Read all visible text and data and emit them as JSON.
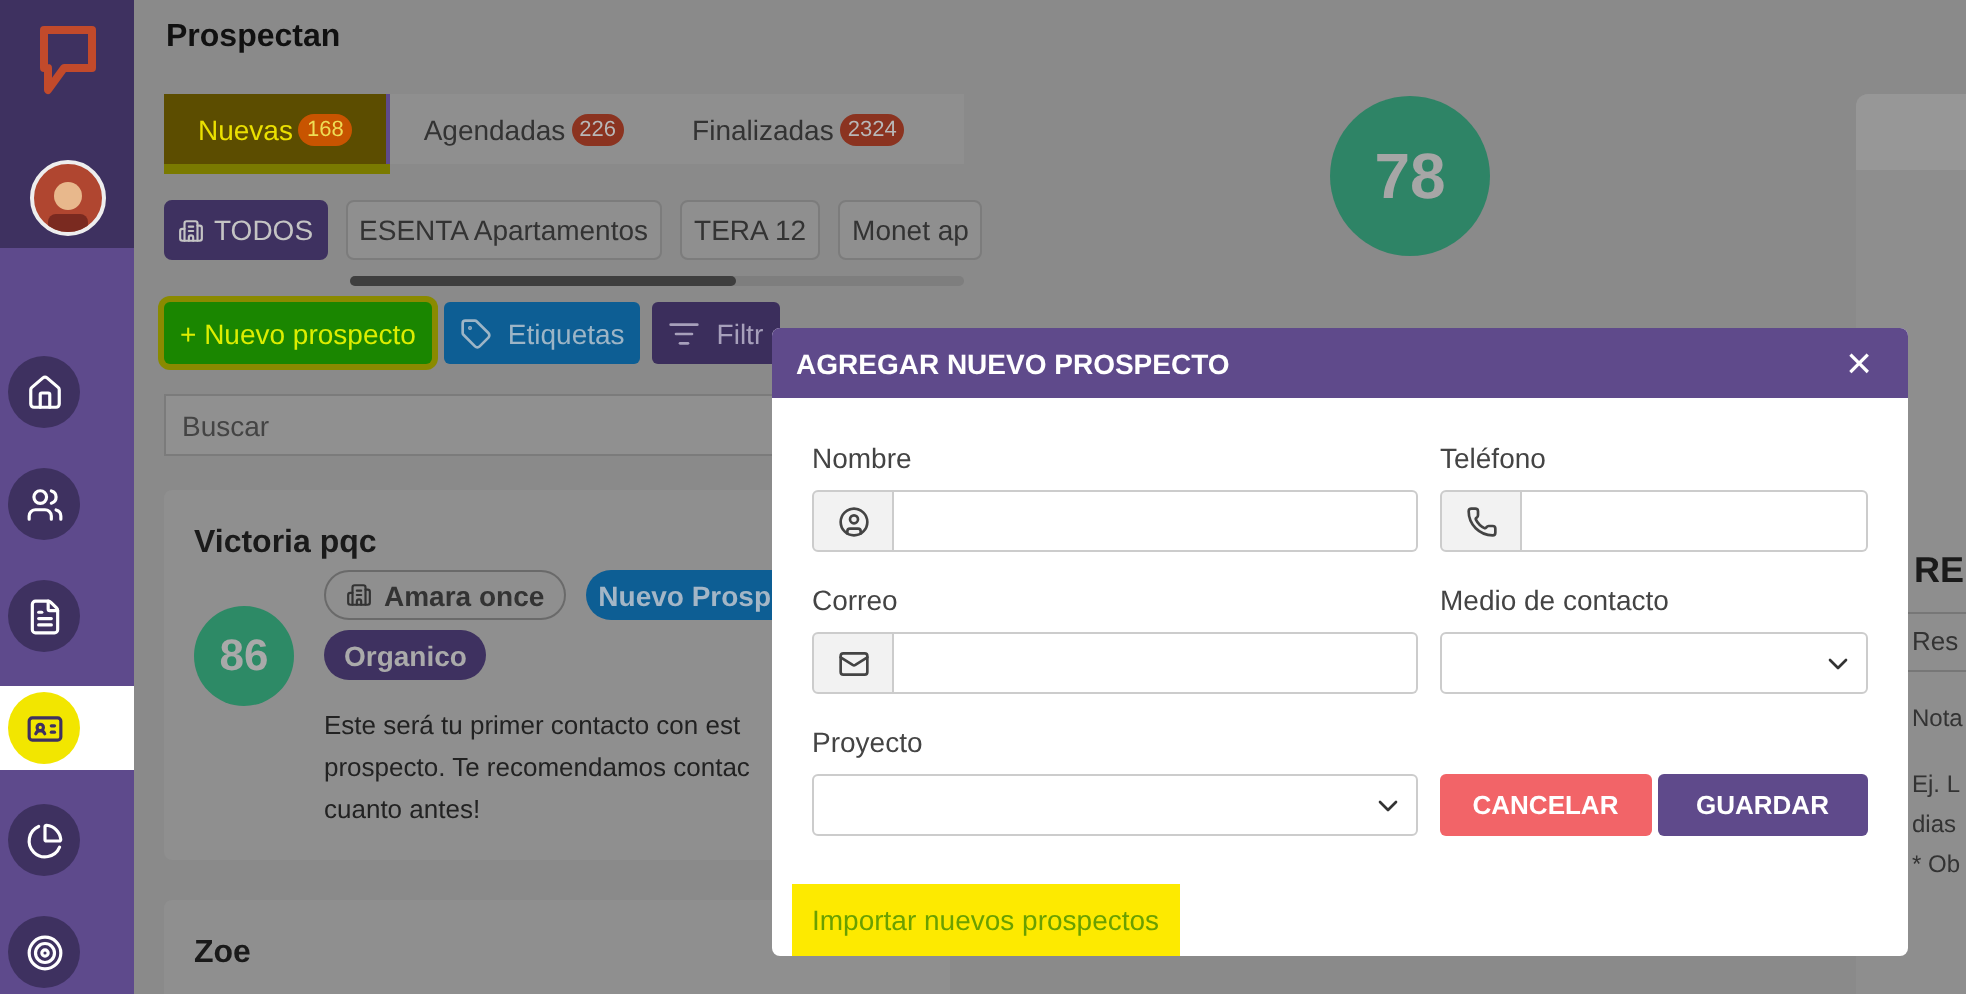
{
  "sidebar": {
    "nav_items": [
      {
        "kind": "home",
        "selected": false,
        "highlighted": false
      },
      {
        "kind": "users",
        "selected": false,
        "highlighted": false
      },
      {
        "kind": "document",
        "selected": false,
        "highlighted": false
      },
      {
        "kind": "contact",
        "selected": true,
        "highlighted": true
      },
      {
        "kind": "chart",
        "selected": false,
        "highlighted": false
      },
      {
        "kind": "target",
        "selected": false,
        "highlighted": false
      }
    ]
  },
  "page": {
    "title": "Prospectan"
  },
  "tabs": [
    {
      "label": "Nuevas",
      "count": "168",
      "selected": true,
      "highlighted": true
    },
    {
      "label": "Agendadas",
      "count": "226",
      "selected": false,
      "highlighted": false
    },
    {
      "label": "Finalizadas",
      "count": "2324",
      "selected": false,
      "highlighted": false
    }
  ],
  "project_chips": [
    {
      "label": "TODOS",
      "selected": true
    },
    {
      "label": "ESENTA Apartamentos",
      "selected": false
    },
    {
      "label": "TERA 12",
      "selected": false
    },
    {
      "label": "Monet ap",
      "selected": false
    }
  ],
  "actions": [
    {
      "kind": "new",
      "label": "+ Nuevo prospecto",
      "highlighted": true
    },
    {
      "kind": "tags",
      "label": "Etiquetas",
      "highlighted": false
    },
    {
      "kind": "filter",
      "label": "Filtr",
      "highlighted": false
    }
  ],
  "search": {
    "placeholder": "Buscar"
  },
  "cards": [
    {
      "name": "Victoria pqc",
      "score": "86",
      "tags": [
        {
          "kind": "project",
          "label": "Amara once"
        },
        {
          "kind": "status",
          "label": "Nuevo Prosp"
        },
        {
          "kind": "source",
          "label": "Organico"
        }
      ],
      "message_lines": [
        "Este será tu primer contacto con est",
        "prospecto. Te recomendamos contac",
        "cuanto antes!"
      ]
    },
    {
      "name": "Zoe"
    }
  ],
  "score": "78",
  "side_panel": {
    "heading": "RE",
    "field": "Res",
    "notes_label": "Nota",
    "hint_lines": [
      "Ej. L",
      "dias",
      "* Ob"
    ]
  },
  "modal": {
    "title": "AGREGAR NUEVO PROSPECTO",
    "close": "×",
    "fields": [
      {
        "kind": "name",
        "label": "Nombre"
      },
      {
        "kind": "phone",
        "label": "Teléfono"
      },
      {
        "kind": "email",
        "label": "Correo"
      },
      {
        "kind": "select",
        "label": "Medio de contacto"
      },
      {
        "kind": "select",
        "label": "Proyecto"
      }
    ],
    "buttons": [
      {
        "kind": "cancel",
        "label": "CANCELAR"
      },
      {
        "kind": "save",
        "label": "GUARDAR"
      }
    ],
    "link": {
      "label": "Importar nuevos prospectos",
      "highlighted": true
    }
  }
}
